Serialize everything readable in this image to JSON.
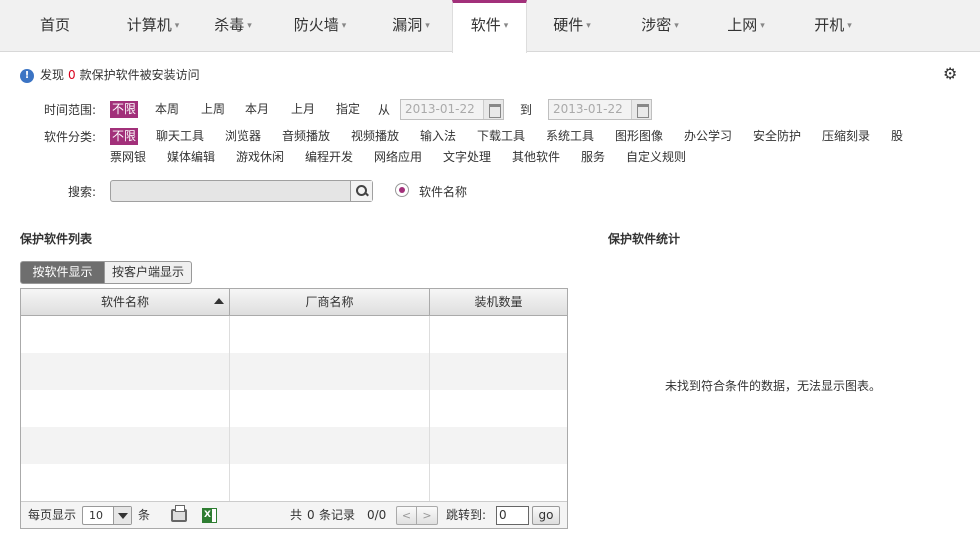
{
  "nav": {
    "tabs": [
      {
        "label": "首页",
        "caret": false
      },
      {
        "label": "计算机",
        "caret": true
      },
      {
        "label": "杀毒",
        "caret": true
      },
      {
        "label": "防火墙",
        "caret": true
      },
      {
        "label": "漏洞",
        "caret": true
      },
      {
        "label": "软件",
        "caret": true,
        "active": true
      },
      {
        "label": "硬件",
        "caret": true
      },
      {
        "label": "涉密",
        "caret": true
      },
      {
        "label": "上网",
        "caret": true
      },
      {
        "label": "开机",
        "caret": true
      }
    ],
    "caret_glyph": "▾"
  },
  "alert": {
    "prefix": "发现",
    "count": "0",
    "suffix": "款保护软件被安装访问",
    "icon": "info-icon"
  },
  "settings_icon": "gear-icon",
  "filters": {
    "time_label": "时间范围:",
    "time_options": [
      "不限",
      "本周",
      "上周",
      "本月",
      "上月",
      "指定"
    ],
    "time_selected": "不限",
    "from_label": "从",
    "to_label": "到",
    "date_from": "2013-01-22",
    "date_to": "2013-01-22",
    "category_label": "软件分类:",
    "categories_row1": [
      "不限",
      "聊天工具",
      "浏览器",
      "音频播放",
      "视频播放",
      "输入法",
      "下载工具",
      "系统工具",
      "图形图像",
      "办公学习",
      "安全防护",
      "压缩刻录",
      "股"
    ],
    "categories_row2": [
      "票网银",
      "媒体编辑",
      "游戏休闲",
      "编程开发",
      "网络应用",
      "文字处理",
      "其他软件",
      "服务",
      "自定义规则"
    ],
    "search_label": "搜索:",
    "search_value": "",
    "search_mode": "软件名称"
  },
  "list": {
    "title": "保护软件列表",
    "view_by_software": "按软件显示",
    "view_by_client": "按客户端显示",
    "columns": [
      "软件名称",
      "厂商名称",
      "装机数量"
    ],
    "rows": []
  },
  "pager": {
    "per_page_label": "每页显示",
    "per_page_value": "10",
    "per_page_unit": "条",
    "total_prefix": "共",
    "total_count": "0",
    "total_suffix": "条记录",
    "page_info": "0/0",
    "prev": "<",
    "next": ">",
    "jump_label": "跳转到:",
    "jump_value": "0",
    "go_label": "go"
  },
  "stats": {
    "title": "保护软件统计",
    "empty_message": "未找到符合条件的数据，无法显示图表。"
  }
}
